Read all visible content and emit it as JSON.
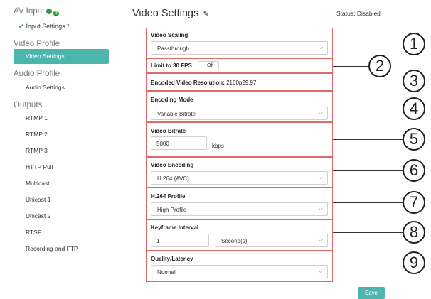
{
  "sidebar": {
    "av_input": "AV Input",
    "input_settings": "Input Settings *",
    "video_profile": "Video Profile",
    "video_settings": "Video Settings",
    "audio_profile": "Audio Profile",
    "audio_settings": "Audio Settings",
    "outputs": "Outputs",
    "output_items": [
      "RTMP 1",
      "RTMP 2",
      "RTMP 3",
      "HTTP Pull",
      "Multicast",
      "Unicast 1",
      "Unicast 2",
      "RTSP",
      "Recording and FTP"
    ]
  },
  "header": {
    "title": "Video Settings",
    "status": "Status: Disabled"
  },
  "form": {
    "video_scaling": {
      "label": "Video Scaling",
      "value": "Passthrough"
    },
    "limit_fps": {
      "label": "Limit to 30 FPS",
      "toggle": "Off"
    },
    "encoded_resolution": {
      "label": "Encoded Video Resolution:",
      "value": "2160p29.97"
    },
    "encoding_mode": {
      "label": "Encoding Mode",
      "value": "Variable Bitrate"
    },
    "video_bitrate": {
      "label": "Video Bitrate",
      "value": "5000",
      "unit": "kbps"
    },
    "video_encoding": {
      "label": "Video Encoding",
      "value": "H.264 (AVC)"
    },
    "h264_profile": {
      "label": "H.264 Profile",
      "value": "High Profile"
    },
    "keyframe_interval": {
      "label": "Keyframe Interval",
      "value": "1",
      "unit": "Second(s)"
    },
    "quality_latency": {
      "label": "Quality/Latency",
      "value": "Normal"
    }
  },
  "callouts": [
    "1",
    "2",
    "3",
    "4",
    "5",
    "6",
    "7",
    "8",
    "9"
  ],
  "save_label": "Save",
  "colors": {
    "accent": "#4db6ac",
    "callout_border": "#e06a6a",
    "status_green": "#2e9d3a"
  }
}
